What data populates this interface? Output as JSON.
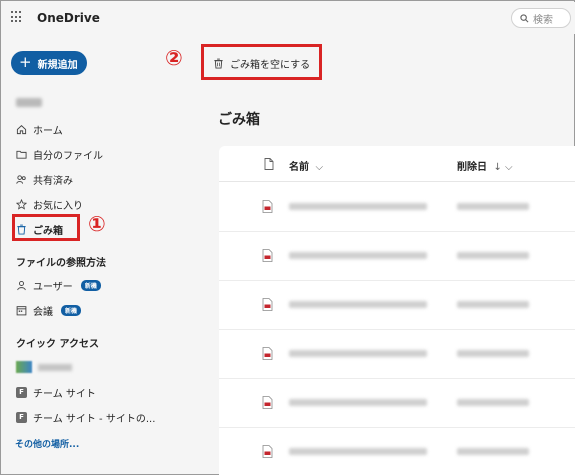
{
  "app": {
    "title": "OneDrive"
  },
  "search": {
    "placeholder": "検索"
  },
  "sidebar": {
    "new_button": "新規追加",
    "items": [
      {
        "label": "ホーム",
        "icon": "home-icon"
      },
      {
        "label": "自分のファイル",
        "icon": "folder-icon"
      },
      {
        "label": "共有済み",
        "icon": "people-icon"
      },
      {
        "label": "お気に入り",
        "icon": "star-icon"
      },
      {
        "label": "ごみ箱",
        "icon": "trash-icon"
      }
    ],
    "browse_section": "ファイルの参照方法",
    "browse_items": [
      {
        "label": "ユーザー",
        "badge": "新機",
        "icon": "person-icon"
      },
      {
        "label": "会議",
        "badge": "新機",
        "icon": "calendar-icon"
      }
    ],
    "quick_access_section": "クイック アクセス",
    "quick_items": [
      {
        "label": "チーム サイト",
        "icon_letter": "F"
      },
      {
        "label": "チーム サイト - サイトの...",
        "icon_letter": "F"
      }
    ],
    "more_link": "その他の場所..."
  },
  "annotations": {
    "marker1": "①",
    "marker2": "②"
  },
  "command_bar": {
    "empty_trash": "ごみ箱を空にする"
  },
  "main": {
    "title": "ごみ箱",
    "columns": {
      "name": "名前",
      "name_sort": "⌵",
      "deleted": "削除日",
      "deleted_sort": "↓ ⌵"
    },
    "row_count": 6
  },
  "colors": {
    "accent": "#115ea3",
    "highlight": "#d92424",
    "pdf": "#c4262e"
  }
}
